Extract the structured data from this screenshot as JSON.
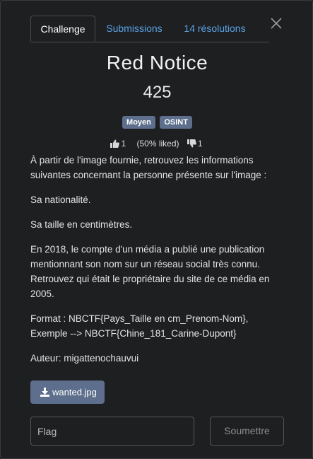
{
  "tabs": [
    {
      "label": "Challenge",
      "active": true
    },
    {
      "label": "Submissions",
      "active": false
    },
    {
      "label": "14 résolutions",
      "active": false
    }
  ],
  "challenge": {
    "title": "Red Notice",
    "points": "425",
    "tags": [
      "Moyen",
      "OSINT"
    ],
    "likes": "1",
    "liked_pct": "(50% liked)",
    "dislikes": "1",
    "description": [
      "À partir de l'image fournie, retrouvez les informations suivantes concernant la personne présente sur l'image :",
      "Sa nationalité.",
      "Sa taille en centimètres.",
      "En 2018, le compte d'un média a publié une publication mentionnant son nom sur un réseau social très connu. Retrouvez qui était le propriétaire du site de ce média en 2005.",
      "Format : NBCTF{Pays_Taille en cm_Prenom-Nom}, Exemple --> NBCTF{Chine_181_Carine-Dupont}",
      "Auteur: migattenochauvui"
    ],
    "file_label": "wanted.jpg"
  },
  "form": {
    "flag_placeholder": "Flag",
    "submit_label": "Soumettre"
  },
  "colors": {
    "background": "#1e1f21",
    "accent": "#5aa3e6",
    "badge": "#5d6f8c"
  },
  "icons": {
    "close": "close-icon",
    "like": "thumbs-up-icon",
    "dislike": "thumbs-down-icon",
    "download": "download-icon"
  }
}
